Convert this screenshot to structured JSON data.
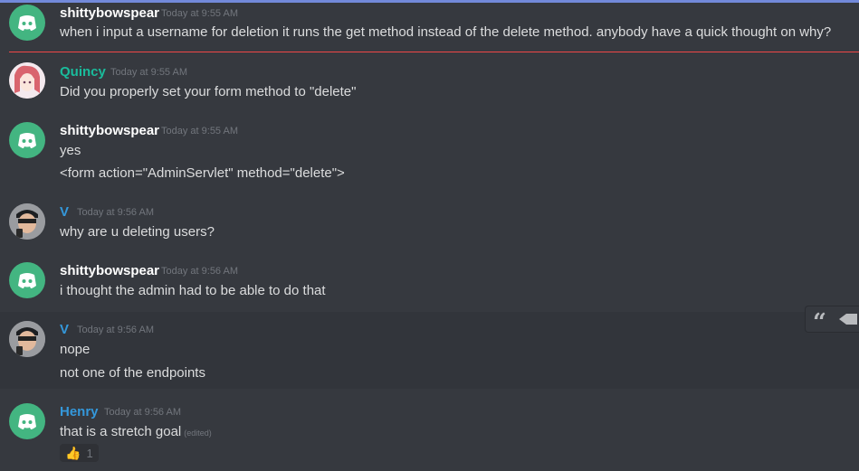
{
  "messages": [
    {
      "author": "shittybowspear",
      "author_color": "#ffffff",
      "avatar": "discord-logo-icon",
      "timestamp": "Today at 9:55 AM",
      "lines": [
        "when i input a username for deletion it runs the get method instead of the delete method. anybody have a quick thought on why?"
      ]
    },
    {
      "author": "Quincy",
      "author_color": "#1abc9c",
      "avatar": "anime-avatar",
      "timestamp": "Today at 9:55 AM",
      "lines": [
        "Did you properly set your form method to \"delete\""
      ]
    },
    {
      "author": "shittybowspear",
      "author_color": "#ffffff",
      "avatar": "discord-logo-icon",
      "timestamp": "Today at 9:55 AM",
      "lines": [
        "yes",
        "<form action=\"AdminServlet\" method=\"delete\">"
      ]
    },
    {
      "author": "V",
      "author_color": "#3498db",
      "avatar": "photo-avatar",
      "timestamp": "Today at 9:56 AM",
      "lines": [
        "why are u deleting users?"
      ]
    },
    {
      "author": "shittybowspear",
      "author_color": "#ffffff",
      "avatar": "discord-logo-icon",
      "timestamp": "Today at 9:56 AM",
      "lines": [
        "i thought the admin had to be able to do that"
      ]
    },
    {
      "author": "V",
      "author_color": "#3498db",
      "avatar": "photo-avatar",
      "timestamp": "Today at 9:56 AM",
      "lines": [
        "nope",
        "not one of the endpoints"
      ]
    },
    {
      "author": "Henry",
      "author_color": "#3498db",
      "avatar": "discord-logo-icon",
      "timestamp": "Today at 9:56 AM",
      "lines": [
        "that is a stretch goal"
      ],
      "edited": "(edited)",
      "reaction": {
        "emoji": "👍",
        "count": "1"
      }
    }
  ],
  "colors": {
    "background": "#36393f",
    "new_message_divider": "#f04747",
    "discord_avatar": "#43b581"
  },
  "hover_actions": [
    "quote-icon",
    "react-icon"
  ]
}
